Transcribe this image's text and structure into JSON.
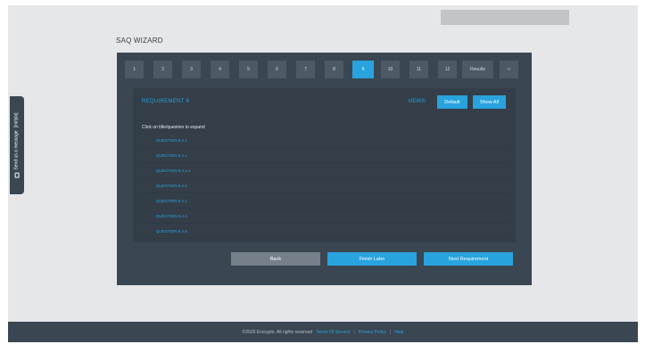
{
  "page_title": "SAQ WIZARD",
  "steps": [
    {
      "label": "1",
      "active": false
    },
    {
      "label": "2",
      "active": false
    },
    {
      "label": "3",
      "active": false
    },
    {
      "label": "4",
      "active": false
    },
    {
      "label": "5",
      "active": false
    },
    {
      "label": "6",
      "active": false
    },
    {
      "label": "7",
      "active": false
    },
    {
      "label": "8",
      "active": false
    },
    {
      "label": "9",
      "active": true
    },
    {
      "label": "10",
      "active": false
    },
    {
      "label": "11",
      "active": false
    },
    {
      "label": "12",
      "active": false
    },
    {
      "label": "Results",
      "active": false
    },
    {
      "label": "»",
      "active": false
    }
  ],
  "requirement": {
    "title": "REQUIREMENT 9",
    "views_label": "VIEWS:",
    "view_default": "Default",
    "view_show_all": "Show All",
    "hint": "Click on title/question to expand",
    "questions": [
      "QUESTION 9.2.1",
      "QUESTION 9.4.1",
      "QUESTION 9.4.1.1",
      "QUESTION 9.4.3",
      "QUESTION 9.4.3",
      "QUESTION 9.4.4",
      "QUESTION 9.4.6"
    ]
  },
  "actions": {
    "back": "Back",
    "finish_later": "Finish Later",
    "next": "Next Requirement"
  },
  "side_tab": {
    "label": "Send us a message",
    "brand": "[imifyla]"
  },
  "footer": {
    "copyright": "©2026 Encrypto. All rights reserved",
    "terms": "Terms Of Service",
    "privacy": "Privacy Policy",
    "help": "Help",
    "separator": "|"
  },
  "colors": {
    "accent": "#29a3dd",
    "panel": "#3a4652",
    "panel_inner": "#333e48",
    "step_bg": "#4d5966",
    "back_button": "#76808a"
  }
}
